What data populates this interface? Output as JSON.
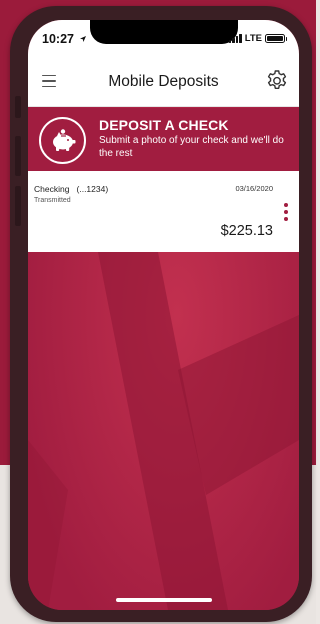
{
  "status_bar": {
    "time": "10:27",
    "network": "LTE"
  },
  "nav": {
    "title": "Mobile Deposits",
    "menu_icon": "hamburger-menu-icon",
    "settings_icon": "gear-icon"
  },
  "banner": {
    "title": "DEPOSIT A CHECK",
    "subtitle": "Submit a photo of your check and we'll do the rest",
    "icon": "piggy-bank-icon"
  },
  "deposits": [
    {
      "account": "Checking   (...1234)",
      "status": "Transmitted",
      "date": "03/16/2020",
      "amount": "$225.13"
    }
  ],
  "colors": {
    "brand": "#a11d40",
    "background_red": "#9b1b3b",
    "card": "#ffffff"
  }
}
